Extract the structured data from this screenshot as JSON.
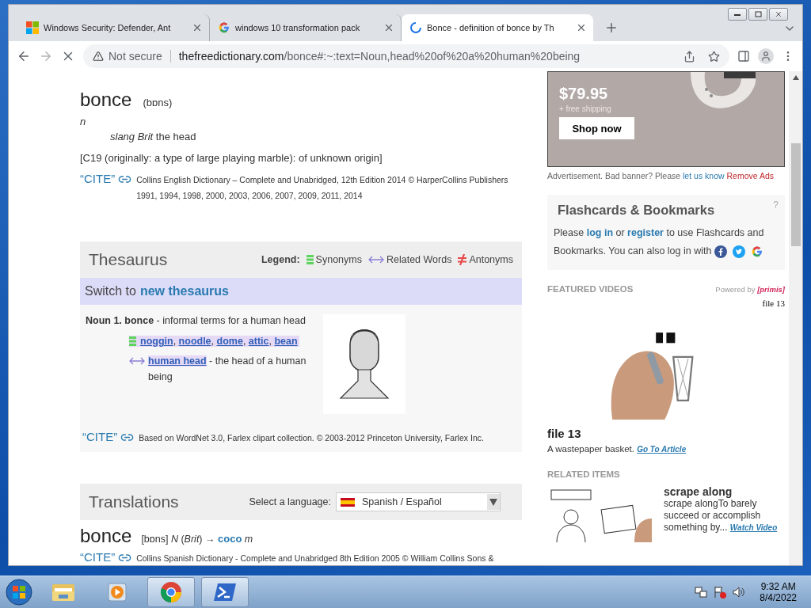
{
  "tabs": [
    {
      "kind": "windows",
      "title": "Windows Security: Defender, Ant",
      "selected": false
    },
    {
      "kind": "google",
      "title": "windows 10 transformation pack",
      "selected": false
    },
    {
      "kind": "loading",
      "title": "Bonce - definition of bonce by Th",
      "selected": true
    }
  ],
  "address_bar": {
    "loading": true,
    "security": "Not secure",
    "domain": "thefreedictionary.com",
    "path": "/bonce#:~:text=Noun,head%20of%20a%20human%20being"
  },
  "entry": {
    "headword": "bonce",
    "pronunciation": "(bɒns)",
    "part_of_speech": "n",
    "definition": "*slang Brit* the head",
    "etymology": "[C19 (originally: a type of large playing marble): of unknown origin]",
    "cite": {
      "label": "“CITE”",
      "source": "Collins English Dictionary – Complete and Unabridged, 12th Edition 2014 © HarperCollins Publishers 1991, 1994, 1998, 2000, 2003, 2006, 2007, 2009, 2011, 2014"
    }
  },
  "thesaurus": {
    "title": "Thesaurus",
    "legend_label": "Legend:",
    "legend": [
      {
        "kind": "synonyms",
        "label": "Synonyms"
      },
      {
        "kind": "related",
        "label": "Related Words"
      },
      {
        "kind": "antonyms",
        "label": "Antonyms"
      }
    ],
    "switch_text": "Switch to",
    "switch_link": "new thesaurus",
    "sense": "**Noun 1. bonce** - informal terms for a human head",
    "synonyms": [
      "noggin",
      "noodle",
      "dome",
      "attic",
      "bean"
    ],
    "separator": ", ",
    "related": {
      "link": "human head",
      "gloss": " - the head of a human being"
    },
    "cite": {
      "label": "“CITE”",
      "source": "Based on WordNet 3.0, Farlex clipart collection. © 2003-2012 Princeton University, Farlex Inc."
    }
  },
  "translations": {
    "title": "Translations",
    "select_label": "Select a language:",
    "language": "Spanish / Español",
    "headword": "bonce",
    "pronunciation": "[bɒns]",
    "gloss": "*N* (*Brit*) →",
    "translation": "coco",
    "gender": "m",
    "cite": {
      "label": "“CITE”",
      "source": "Collins Spanish Dictionary - Complete and Unabridged 8th Edition 2005 © William Collins Sons &"
    }
  },
  "ad": {
    "price": "$79.95",
    "shipping": "+ free shipping",
    "button": "Shop now",
    "note": "Advertisement. Bad banner? Please",
    "link": "let us know",
    "remove": "Remove Ads"
  },
  "flashcards": {
    "title": "Flashcards & Bookmarks",
    "help": "?",
    "lines": [
      [
        {
          "kind": "text",
          "text": "Please "
        },
        {
          "kind": "link",
          "text": "log in"
        },
        {
          "kind": "text",
          "text": " or "
        },
        {
          "kind": "link",
          "text": "register"
        },
        {
          "kind": "text",
          "text": " to use Flashcards and"
        }
      ],
      [
        {
          "kind": "text",
          "text": "Bookmarks. You can also log in with"
        }
      ]
    ],
    "logins": [
      {
        "kind": "facebook"
      },
      {
        "kind": "twitter"
      },
      {
        "kind": "google"
      }
    ]
  },
  "featured": {
    "heading": "FEATURED VIDEOS",
    "powered_by": "Powered by",
    "brand": "[primis]",
    "player_title": "file 13",
    "title": "file 13",
    "caption": "A wastepaper basket.",
    "link": "Go To Article"
  },
  "related": {
    "heading": "RELATED ITEMS",
    "items": [
      {
        "title": "scrape along",
        "text": "scrape alongTo barely succeed or accomplish something by...",
        "link": "Watch Video"
      }
    ]
  },
  "taskbar": {
    "apps": [
      {
        "kind": "explorer",
        "running": false
      },
      {
        "kind": "media",
        "running": false
      },
      {
        "kind": "chrome",
        "running": true
      },
      {
        "kind": "powershell",
        "running": true
      }
    ],
    "time": "9:32 AM",
    "date": "8/4/2022"
  }
}
